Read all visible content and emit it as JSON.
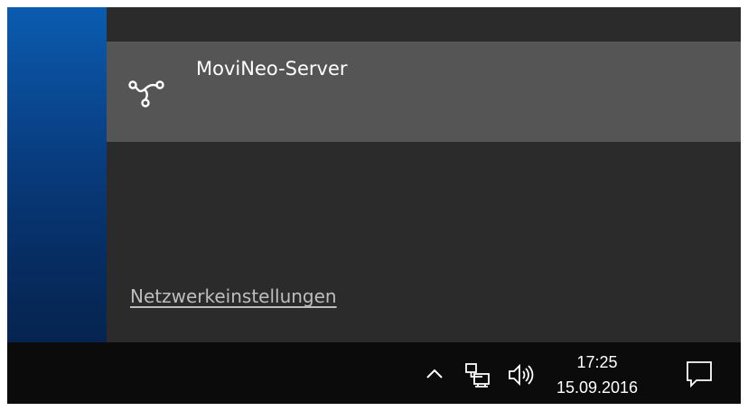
{
  "flyout": {
    "network_name": "MoviNeo-Server",
    "settings_link": "Netzwerkeinstellungen",
    "icon": "network-connection-icon"
  },
  "taskbar": {
    "time": "17:25",
    "date": "15.09.2016",
    "icons": [
      "chevron-up-icon",
      "network-icon",
      "volume-icon",
      "action-center-icon"
    ]
  },
  "colors": {
    "desktop_accent": "#0a5cb0",
    "flyout_bg": "#2b2b2b",
    "item_hover_bg": "#555555",
    "taskbar_bg": "#0b0b0b",
    "text_primary": "#ffffff",
    "link_text": "#bdbdbd"
  }
}
